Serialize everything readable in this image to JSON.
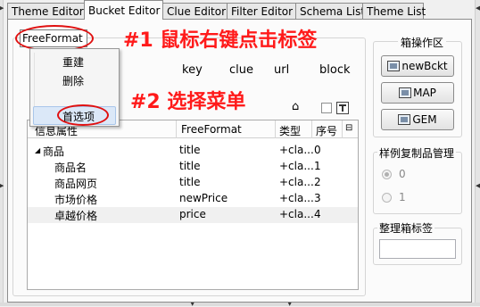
{
  "tabs": [
    "Theme Editor",
    "Bucket Editor",
    "Clue Editor",
    "Filter Editor",
    "Schema List",
    "Theme List"
  ],
  "active_tab": 1,
  "format_combo": {
    "value": "FreeFormat"
  },
  "annotations": {
    "step1_label": "#1 鼠标右键点击标签",
    "step2_label": "#2 选择菜单"
  },
  "context_menu": {
    "items": [
      "重建",
      "删除",
      "首选项"
    ],
    "highlighted": "首选项"
  },
  "column_headers": [
    "key",
    "clue",
    "url",
    "block"
  ],
  "table": {
    "headers": [
      "信息属性",
      "FreeFormat",
      "类型",
      "序号"
    ],
    "rows": [
      {
        "name": "商品",
        "value": "title",
        "type": "+cla...",
        "index": "0",
        "expander": "◢"
      },
      {
        "name": "商品名",
        "value": "title",
        "type": "+cla...",
        "index": "1"
      },
      {
        "name": "商品网页",
        "value": "title",
        "type": "+cla...",
        "index": "2"
      },
      {
        "name": "市场价格",
        "value": "newPrice",
        "type": "+cla...",
        "index": "3"
      },
      {
        "name": "卓越价格",
        "value": "price",
        "type": "+cla...",
        "index": "4"
      }
    ]
  },
  "operations_group": {
    "title": "箱操作区",
    "buttons": [
      "newBckt",
      "MAP",
      "GEM"
    ]
  },
  "sample_group": {
    "title": "样例复制品管理",
    "options": [
      "0",
      "1"
    ]
  },
  "tag_group": {
    "title": "整理箱标签",
    "value": ""
  },
  "colors": {
    "annotation": "#ff1a1a",
    "highlight": "#dbe8f8"
  }
}
